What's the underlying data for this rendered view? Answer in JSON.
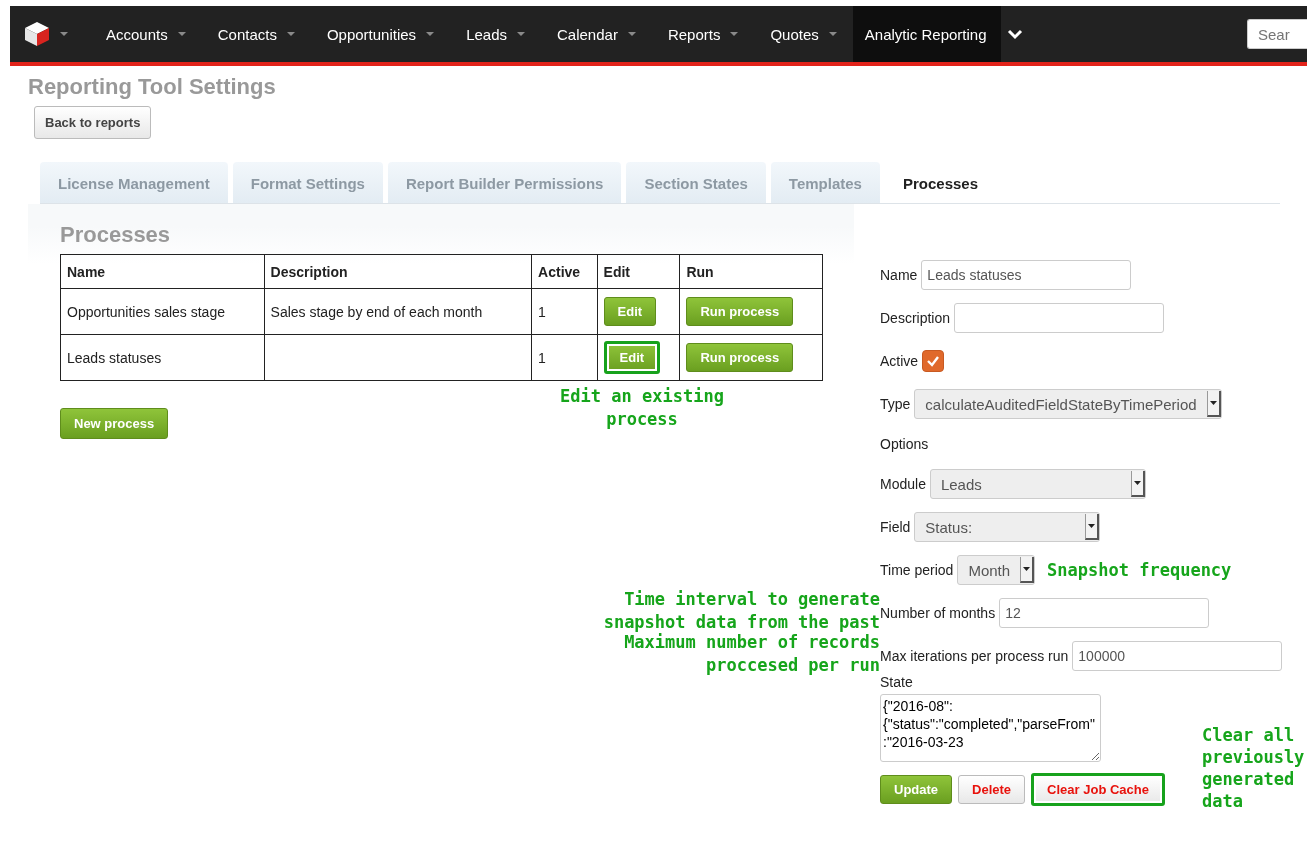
{
  "nav": {
    "items": [
      {
        "label": "Accounts",
        "selected": false
      },
      {
        "label": "Contacts",
        "selected": false
      },
      {
        "label": "Opportunities",
        "selected": false
      },
      {
        "label": "Leads",
        "selected": false
      },
      {
        "label": "Calendar",
        "selected": false
      },
      {
        "label": "Reports",
        "selected": false
      },
      {
        "label": "Quotes",
        "selected": false
      },
      {
        "label": "Analytic Reporting",
        "selected": true
      }
    ],
    "search": {
      "placeholder": "Sear"
    }
  },
  "page_title": "Reporting Tool Settings",
  "back_button": "Back to reports",
  "tabs": [
    {
      "label": "License Management",
      "selected": false
    },
    {
      "label": "Format Settings",
      "selected": false
    },
    {
      "label": "Report Builder Permissions",
      "selected": false
    },
    {
      "label": "Section States",
      "selected": false
    },
    {
      "label": "Templates",
      "selected": false
    },
    {
      "label": "Processes",
      "selected": true
    }
  ],
  "section_title": "Processes",
  "table": {
    "columns": [
      "Name",
      "Description",
      "Active",
      "Edit",
      "Run"
    ],
    "rows": [
      {
        "name": "Opportunities sales stage",
        "description": "Sales stage by end of each month",
        "active": "1",
        "edit": "Edit",
        "run": "Run process",
        "highlighted": false
      },
      {
        "name": "Leads statuses",
        "description": "",
        "active": "1",
        "edit": "Edit",
        "run": "Run process",
        "highlighted": true
      }
    ],
    "note": "Edit an existing process"
  },
  "new_button": "New process",
  "form": {
    "fields": [
      {
        "kind": "text",
        "label": "Name",
        "value": "Leads statuses"
      },
      {
        "kind": "text",
        "label": "Description"
      },
      {
        "kind": "checkbox",
        "label": "Active",
        "checked": true
      },
      {
        "kind": "select",
        "label": "Type",
        "value": "calculateAuditedFieldStateByTimePeriod"
      },
      {
        "kind": "heading",
        "label": "Options"
      },
      {
        "kind": "select",
        "label": "Module",
        "value": "Leads"
      },
      {
        "kind": "select",
        "label": "Field",
        "value": "Status:"
      },
      {
        "kind": "select",
        "label": "Time period",
        "value": "Month",
        "note_right": "Snapshot frequency"
      },
      {
        "kind": "text",
        "label": "Number of months",
        "value": "12",
        "note_left": "Time interval to generate snapshot data from the past"
      },
      {
        "kind": "text",
        "label": "Max iterations per process run",
        "value": "100000",
        "note_left": "Maximum number of records proccesed per run"
      },
      {
        "kind": "textarea",
        "label": "State",
        "value": "{\"2016-08\":\n{\"status\":\"completed\",\"parseFrom\":\"2016-03-23"
      }
    ],
    "buttons": [
      {
        "label": "Update",
        "kind": "primary",
        "highlighted": false
      },
      {
        "label": "Delete",
        "kind": "danger",
        "highlighted": false
      },
      {
        "label": "Clear Job Cache",
        "kind": "danger",
        "highlighted": true
      }
    ],
    "note": "Clear all previously generated data"
  }
}
